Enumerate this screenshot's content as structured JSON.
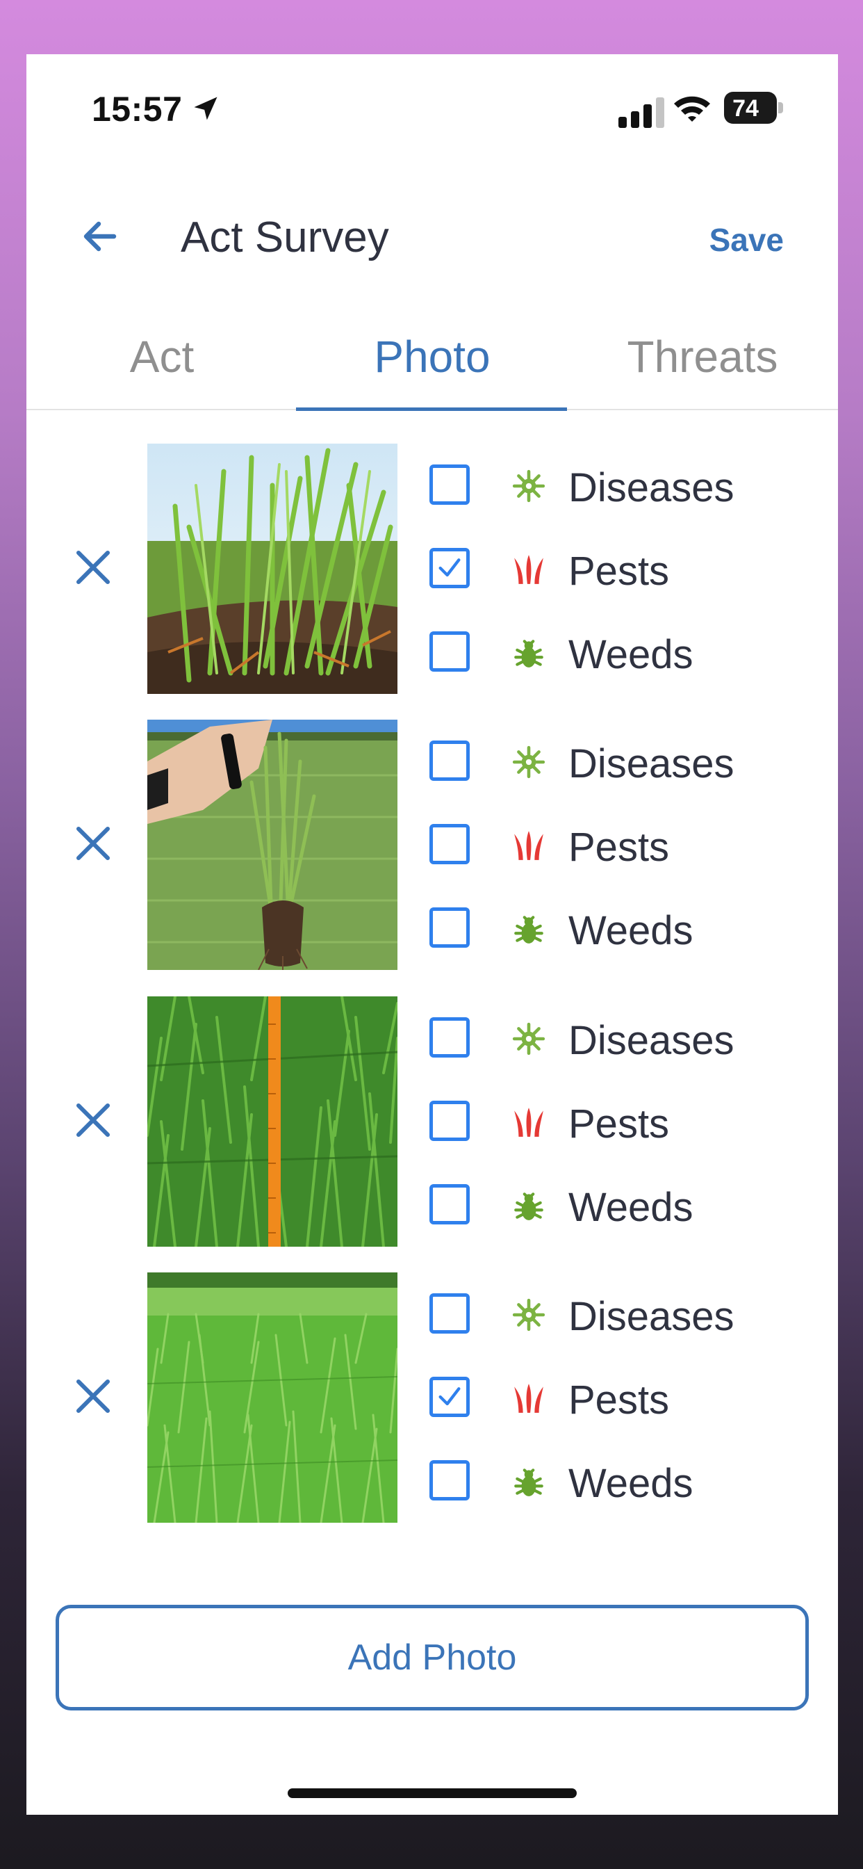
{
  "status_bar": {
    "time": "15:57",
    "battery": "74"
  },
  "header": {
    "title": "Act Survey",
    "save_label": "Save"
  },
  "tabs": [
    {
      "label": "Act",
      "active": false
    },
    {
      "label": "Photo",
      "active": true
    },
    {
      "label": "Threats",
      "active": false
    }
  ],
  "threat_labels": {
    "diseases": "Diseases",
    "pests": "Pests",
    "weeds": "Weeds"
  },
  "photos": [
    {
      "image": "wheat seedlings close-up",
      "diseases": false,
      "pests": true,
      "weeds": false
    },
    {
      "image": "hand holding uprooted wheat plants",
      "diseases": false,
      "pests": false,
      "weeds": false
    },
    {
      "image": "wheat field with orange measuring stick",
      "diseases": false,
      "pests": false,
      "weeds": false
    },
    {
      "image": "green grass field",
      "diseases": false,
      "pests": true,
      "weeds": false
    }
  ],
  "add_photo_label": "Add Photo",
  "colors": {
    "accent": "#3b74b8",
    "checkbox": "#2f80ed",
    "disease_icon": "#7cb342",
    "pest_icon": "#e53935",
    "weed_icon": "#66a32e"
  },
  "icons": {
    "back": "arrow-left-icon",
    "remove": "close-icon",
    "diseases": "virus-icon",
    "pests": "grass-blades-icon",
    "weeds": "bug-icon"
  }
}
